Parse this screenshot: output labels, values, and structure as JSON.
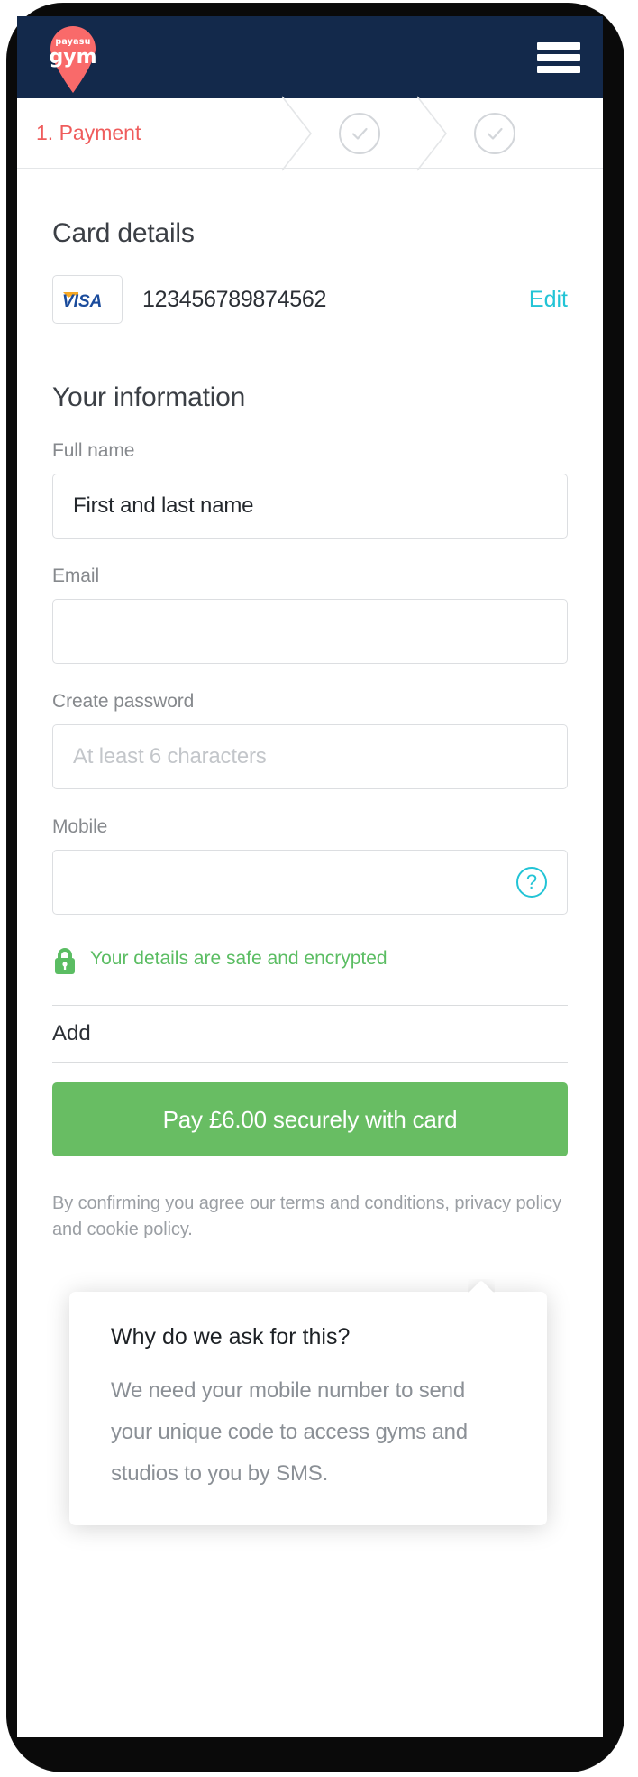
{
  "brand": {
    "logo_line1": "payasu",
    "logo_line2": "gym",
    "navbar_color": "#13294b",
    "pin_color": "#f96a6a",
    "accent_cyan": "#22c4d6",
    "accent_green": "#68bd63",
    "accent_red": "#ef5c5c"
  },
  "topbar": {
    "menu_label": "menu"
  },
  "steps": [
    {
      "label": "1. Payment",
      "state": "active",
      "icon": ""
    },
    {
      "label": "",
      "state": "complete",
      "icon": "check-circle-icon"
    },
    {
      "label": "",
      "state": "complete",
      "icon": "check-circle-icon"
    }
  ],
  "card_details": {
    "title": "Card details",
    "brand_logo": "VISA",
    "number": "123456789874562",
    "edit_label": "Edit"
  },
  "your_information": {
    "title": "Your information",
    "fields": [
      {
        "label": "Full name",
        "value": "First and last name",
        "placeholder": ""
      },
      {
        "label": "Email",
        "value": "",
        "placeholder": ""
      },
      {
        "label": "Create password",
        "value": "",
        "placeholder": "At least 6 characters"
      },
      {
        "label": "Mobile",
        "value": "",
        "placeholder": "",
        "help_icon": "question-mark-icon"
      }
    ]
  },
  "secure_note": {
    "icon": "padlock-icon",
    "text": "Your details are safe and encrypted"
  },
  "promo": {
    "label": "Add"
  },
  "tooltip": {
    "title": "Why do we ask for this?",
    "body": "We need your mobile number to send your unique code to access gyms and studios to you by SMS."
  },
  "pay": {
    "button_label": "Pay £6.00 securely with card",
    "amount": "£6.00",
    "terms": "By confirming you agree our terms and conditions, privacy policy and cookie policy."
  }
}
